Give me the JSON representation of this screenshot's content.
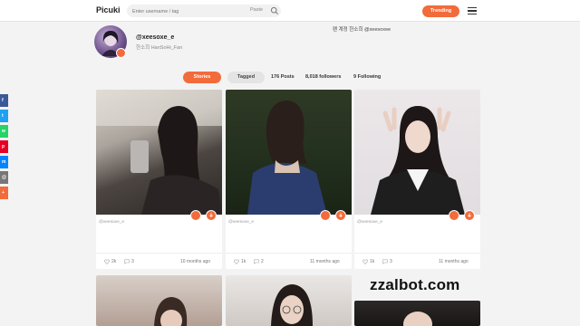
{
  "header": {
    "logo": "Picuki",
    "search_placeholder": "Enter username / tag",
    "paste_label": "Paste",
    "trending_label": "Trending"
  },
  "profile": {
    "username": "@xeesoxe_e",
    "full_name": "한소희 HanSoHi_Fan",
    "bio": "팬 계정 한소희 @xeesoxee"
  },
  "tabs": {
    "stories": "Stories",
    "tagged": "Tagged"
  },
  "stats": {
    "posts": "176 Posts",
    "followers": "8,018 followers",
    "following": "9 Following"
  },
  "social_icons": [
    "facebook-icon",
    "twitter-icon",
    "whatsapp-icon",
    "pinterest-icon",
    "messenger-icon",
    "email-icon",
    "share-icon"
  ],
  "posts": [
    {
      "author": "@xeesoxe_e",
      "likes": "2k",
      "comments": "3",
      "time": "10 months ago"
    },
    {
      "author": "@xeesoxe_e",
      "likes": "1k",
      "comments": "2",
      "time": "11 months ago"
    },
    {
      "author": "@xeesoxe_e",
      "likes": "1k",
      "comments": "3",
      "time": "11 months ago"
    }
  ],
  "watermark": "zzalbot.com",
  "colors": {
    "accent": "#f26b3a"
  }
}
